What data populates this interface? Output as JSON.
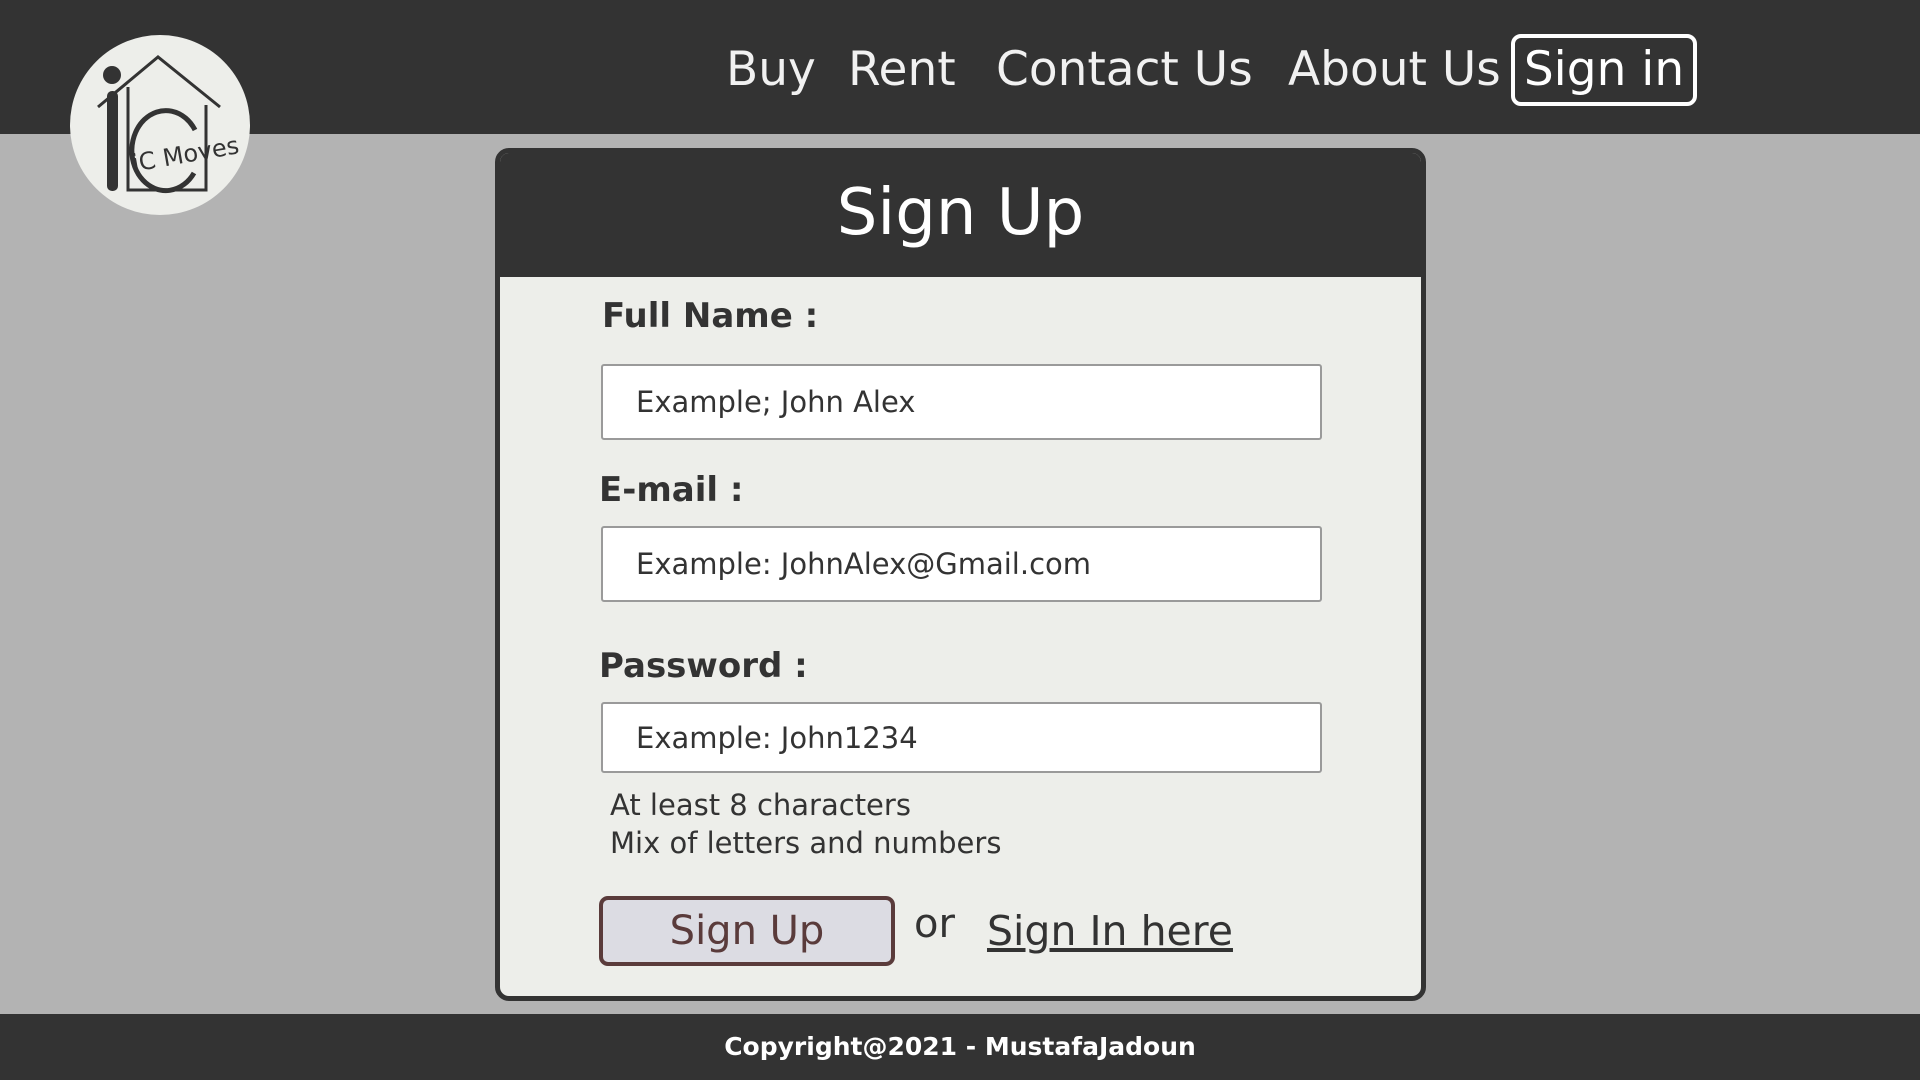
{
  "header": {
    "logo_alt": "iC Moves",
    "nav": {
      "buy": "Buy",
      "rent": "Rent",
      "contact": "Contact Us",
      "about": "About Us",
      "sign_in": "Sign in"
    }
  },
  "form": {
    "title": "Sign Up",
    "full_name": {
      "label": "Full Name :",
      "placeholder": "Example; John Alex"
    },
    "email": {
      "label": "E-mail :",
      "placeholder": "Example: JohnAlex@Gmail.com"
    },
    "password": {
      "label": "Password :",
      "placeholder": "Example: John1234",
      "hints": [
        "At least 8 characters",
        "Mix of letters and numbers"
      ]
    },
    "submit_label": "Sign Up",
    "or_text": "or",
    "sign_in_link": "Sign In here "
  },
  "footer": {
    "copyright": "Copyright@2021 - MustafaJadoun"
  },
  "colors": {
    "header_bg": "#333333",
    "page_bg": "#b3b3b3",
    "card_bg": "#edeeea",
    "button_bg": "#dcdce3",
    "button_border": "#5a3b3b"
  }
}
